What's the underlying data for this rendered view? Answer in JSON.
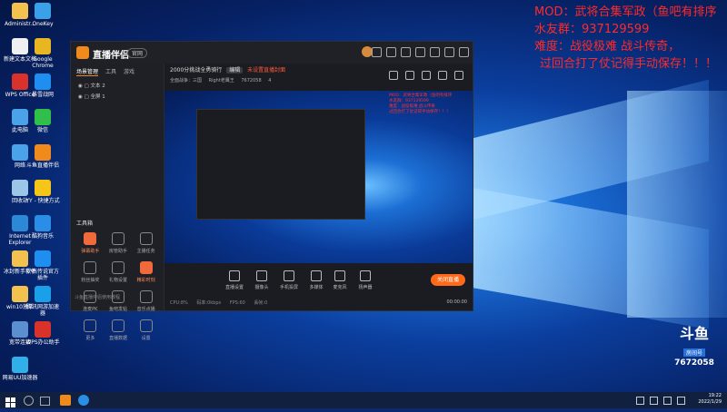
{
  "overlay": {
    "mod_line": "MOD：武将合集军政（鱼吧有排序",
    "group_line": "水友群：937129599",
    "difficulty_line": "难度：战役极难 战斗传奇，",
    "save_line": "过回合打了仗记得手动保存！！！"
  },
  "desktop": {
    "icons": [
      {
        "label": "Administr...",
        "color": "#f2c14e"
      },
      {
        "label": "OneKey",
        "color": "#3aa0e8"
      },
      {
        "label": "新建文本文档",
        "color": "#f0f0f0"
      },
      {
        "label": "WPS Office",
        "color": "#d8322a"
      },
      {
        "label": "Google Chrome",
        "color": "#e8b622"
      },
      {
        "label": "此电脑",
        "color": "#4aa3e8"
      },
      {
        "label": "暴雪战网",
        "color": "#1e8ff0"
      },
      {
        "label": "网络",
        "color": "#4aa3e8"
      },
      {
        "label": "微信",
        "color": "#2fbf4a"
      },
      {
        "label": "回收站",
        "color": "#9cc6e8"
      },
      {
        "label": "斗鱼直播伴侣",
        "color": "#f08a1c"
      },
      {
        "label": "Internet Explorer",
        "color": "#2b8ad8"
      },
      {
        "label": "YY - 快捷方式",
        "color": "#f5c518"
      },
      {
        "label": "冰封新手软件",
        "color": "#f2c14e"
      },
      {
        "label": "酷狗音乐",
        "color": "#2a8ee6"
      },
      {
        "label": "win10激活",
        "color": "#f2c14e"
      },
      {
        "label": "炉石传说官方插件",
        "color": "#1e8ff0"
      },
      {
        "label": "宽带连接",
        "color": "#5a8fd0"
      },
      {
        "label": "腾讯网游加速器",
        "color": "#1aa0e8"
      },
      {
        "label": "网易UU加速器",
        "color": "#2fb0e8"
      },
      {
        "label": "WPS办公助手",
        "color": "#d8322a"
      }
    ]
  },
  "app": {
    "name": "直播伴侣",
    "version": "官网",
    "tabs": [
      "场景管理",
      "工具",
      "游戏"
    ],
    "scenes": [
      "文本 2",
      "全屏 1"
    ],
    "tools_header": "工具箱",
    "tools": [
      {
        "label": "弹幕助手",
        "hot": true
      },
      {
        "label": "房管助手",
        "hot": false
      },
      {
        "label": "主播任务",
        "hot": false
      },
      {
        "label": "粉丝抽奖",
        "hot": false
      },
      {
        "label": "礼物设置",
        "hot": false
      },
      {
        "label": "精彩时刻",
        "hot": true
      },
      {
        "label": "连麦PK",
        "hot": false
      },
      {
        "label": "鱼吧发帖",
        "hot": false
      },
      {
        "label": "音乐点播",
        "hot": false
      },
      {
        "label": "更多",
        "hot": false
      },
      {
        "label": "直播数据",
        "hot": false
      },
      {
        "label": "设置",
        "hot": false
      }
    ],
    "help_text": "斗鱼直播伴侣使用教程",
    "room_title": "2000分挑战全勇骑行",
    "room_tag": "编辑",
    "room_red": "未设置直播封面",
    "category": "全面战争：三国",
    "owner": "Right老鹰王",
    "room_id": "7672058",
    "viewers": "4",
    "preview_overlay": [
      "MOD：武将合集军政（鱼吧有排序",
      "水友群：937129599",
      "难度：战役极难 战斗传奇",
      "过回合打了仗记得手动保存！！！"
    ],
    "controls": [
      "直播设置",
      "摄像头",
      "手机投屏",
      "多媒体",
      "麦克风",
      "扬声器"
    ],
    "go_live": "关闭直播",
    "status": [
      "CPU:8%",
      "码率:0kbps",
      "FPS:60",
      "丢帧:0"
    ],
    "timer": "00:00:00"
  },
  "watermark": {
    "brand": "斗鱼",
    "sub": "房间号",
    "room": "7672058"
  },
  "taskbar": {
    "time": "19:22",
    "date": "2022/1/29"
  }
}
